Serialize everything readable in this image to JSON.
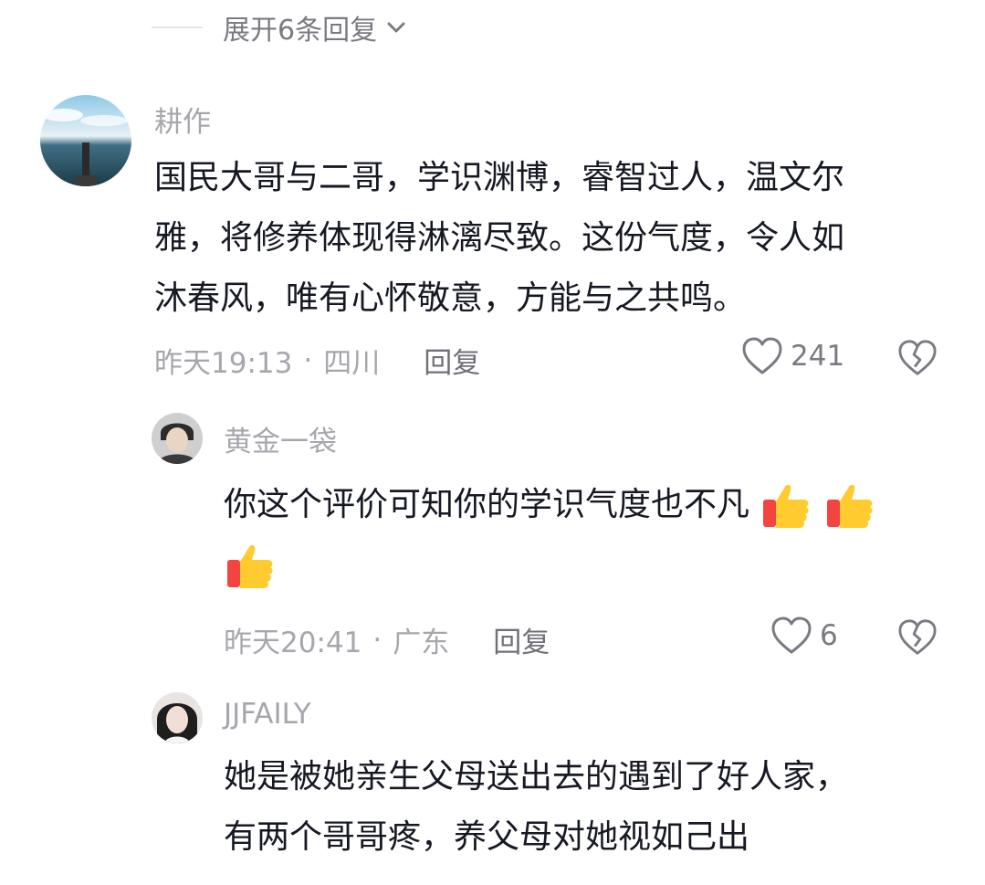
{
  "expand": {
    "label": "展开6条回复"
  },
  "comments": [
    {
      "name": "耕作",
      "text": "国民大哥与二哥，学识渊博，睿智过人，温文尔雅，将修养体现得淋漓尽致。这份气度，令人如沐春风，唯有心怀敬意，方能与之共鸣。",
      "lines": [
        "国民大哥与二哥，学识渊博，睿智过人，温文尔",
        "雅，将修养体现得淋漓尽致。这份气度，令人如",
        "沐春风，唯有心怀敬意，方能与之共鸣。"
      ],
      "time": "昨天19:13",
      "location": "四川",
      "reply_label": "回复",
      "likes": "241"
    },
    {
      "name": "黄金一袋",
      "text": "你这个评价可知你的学识气度也不凡",
      "emoji": "thumbs-up",
      "emoji_count": 3,
      "time": "昨天20:41",
      "location": "广东",
      "reply_label": "回复",
      "likes": "6"
    },
    {
      "name": "JJFAILY",
      "lines": [
        "她是被她亲生父母送出去的遇到了好人家，",
        "有两个哥哥疼，养父母对她视如己出"
      ]
    }
  ],
  "separator": "·",
  "colors": {
    "text": "#161823",
    "muted": "#a6a7ad",
    "reply": "#6f7079"
  }
}
